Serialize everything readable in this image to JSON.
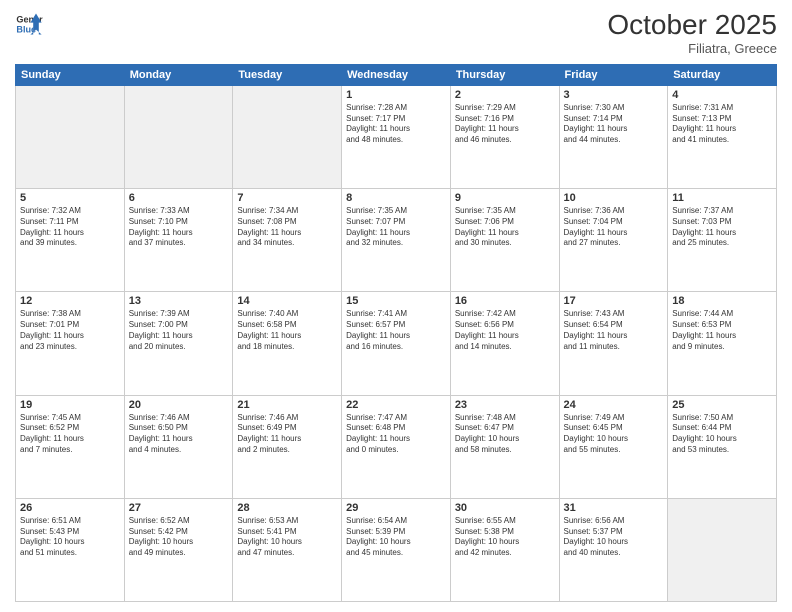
{
  "header": {
    "logo_line1": "General",
    "logo_line2": "Blue",
    "month": "October 2025",
    "location": "Filiatra, Greece"
  },
  "weekdays": [
    "Sunday",
    "Monday",
    "Tuesday",
    "Wednesday",
    "Thursday",
    "Friday",
    "Saturday"
  ],
  "weeks": [
    [
      {
        "day": "",
        "info": ""
      },
      {
        "day": "",
        "info": ""
      },
      {
        "day": "",
        "info": ""
      },
      {
        "day": "1",
        "info": "Sunrise: 7:28 AM\nSunset: 7:17 PM\nDaylight: 11 hours\nand 48 minutes."
      },
      {
        "day": "2",
        "info": "Sunrise: 7:29 AM\nSunset: 7:16 PM\nDaylight: 11 hours\nand 46 minutes."
      },
      {
        "day": "3",
        "info": "Sunrise: 7:30 AM\nSunset: 7:14 PM\nDaylight: 11 hours\nand 44 minutes."
      },
      {
        "day": "4",
        "info": "Sunrise: 7:31 AM\nSunset: 7:13 PM\nDaylight: 11 hours\nand 41 minutes."
      }
    ],
    [
      {
        "day": "5",
        "info": "Sunrise: 7:32 AM\nSunset: 7:11 PM\nDaylight: 11 hours\nand 39 minutes."
      },
      {
        "day": "6",
        "info": "Sunrise: 7:33 AM\nSunset: 7:10 PM\nDaylight: 11 hours\nand 37 minutes."
      },
      {
        "day": "7",
        "info": "Sunrise: 7:34 AM\nSunset: 7:08 PM\nDaylight: 11 hours\nand 34 minutes."
      },
      {
        "day": "8",
        "info": "Sunrise: 7:35 AM\nSunset: 7:07 PM\nDaylight: 11 hours\nand 32 minutes."
      },
      {
        "day": "9",
        "info": "Sunrise: 7:35 AM\nSunset: 7:06 PM\nDaylight: 11 hours\nand 30 minutes."
      },
      {
        "day": "10",
        "info": "Sunrise: 7:36 AM\nSunset: 7:04 PM\nDaylight: 11 hours\nand 27 minutes."
      },
      {
        "day": "11",
        "info": "Sunrise: 7:37 AM\nSunset: 7:03 PM\nDaylight: 11 hours\nand 25 minutes."
      }
    ],
    [
      {
        "day": "12",
        "info": "Sunrise: 7:38 AM\nSunset: 7:01 PM\nDaylight: 11 hours\nand 23 minutes."
      },
      {
        "day": "13",
        "info": "Sunrise: 7:39 AM\nSunset: 7:00 PM\nDaylight: 11 hours\nand 20 minutes."
      },
      {
        "day": "14",
        "info": "Sunrise: 7:40 AM\nSunset: 6:58 PM\nDaylight: 11 hours\nand 18 minutes."
      },
      {
        "day": "15",
        "info": "Sunrise: 7:41 AM\nSunset: 6:57 PM\nDaylight: 11 hours\nand 16 minutes."
      },
      {
        "day": "16",
        "info": "Sunrise: 7:42 AM\nSunset: 6:56 PM\nDaylight: 11 hours\nand 14 minutes."
      },
      {
        "day": "17",
        "info": "Sunrise: 7:43 AM\nSunset: 6:54 PM\nDaylight: 11 hours\nand 11 minutes."
      },
      {
        "day": "18",
        "info": "Sunrise: 7:44 AM\nSunset: 6:53 PM\nDaylight: 11 hours\nand 9 minutes."
      }
    ],
    [
      {
        "day": "19",
        "info": "Sunrise: 7:45 AM\nSunset: 6:52 PM\nDaylight: 11 hours\nand 7 minutes."
      },
      {
        "day": "20",
        "info": "Sunrise: 7:46 AM\nSunset: 6:50 PM\nDaylight: 11 hours\nand 4 minutes."
      },
      {
        "day": "21",
        "info": "Sunrise: 7:46 AM\nSunset: 6:49 PM\nDaylight: 11 hours\nand 2 minutes."
      },
      {
        "day": "22",
        "info": "Sunrise: 7:47 AM\nSunset: 6:48 PM\nDaylight: 11 hours\nand 0 minutes."
      },
      {
        "day": "23",
        "info": "Sunrise: 7:48 AM\nSunset: 6:47 PM\nDaylight: 10 hours\nand 58 minutes."
      },
      {
        "day": "24",
        "info": "Sunrise: 7:49 AM\nSunset: 6:45 PM\nDaylight: 10 hours\nand 55 minutes."
      },
      {
        "day": "25",
        "info": "Sunrise: 7:50 AM\nSunset: 6:44 PM\nDaylight: 10 hours\nand 53 minutes."
      }
    ],
    [
      {
        "day": "26",
        "info": "Sunrise: 6:51 AM\nSunset: 5:43 PM\nDaylight: 10 hours\nand 51 minutes."
      },
      {
        "day": "27",
        "info": "Sunrise: 6:52 AM\nSunset: 5:42 PM\nDaylight: 10 hours\nand 49 minutes."
      },
      {
        "day": "28",
        "info": "Sunrise: 6:53 AM\nSunset: 5:41 PM\nDaylight: 10 hours\nand 47 minutes."
      },
      {
        "day": "29",
        "info": "Sunrise: 6:54 AM\nSunset: 5:39 PM\nDaylight: 10 hours\nand 45 minutes."
      },
      {
        "day": "30",
        "info": "Sunrise: 6:55 AM\nSunset: 5:38 PM\nDaylight: 10 hours\nand 42 minutes."
      },
      {
        "day": "31",
        "info": "Sunrise: 6:56 AM\nSunset: 5:37 PM\nDaylight: 10 hours\nand 40 minutes."
      },
      {
        "day": "",
        "info": ""
      }
    ]
  ]
}
